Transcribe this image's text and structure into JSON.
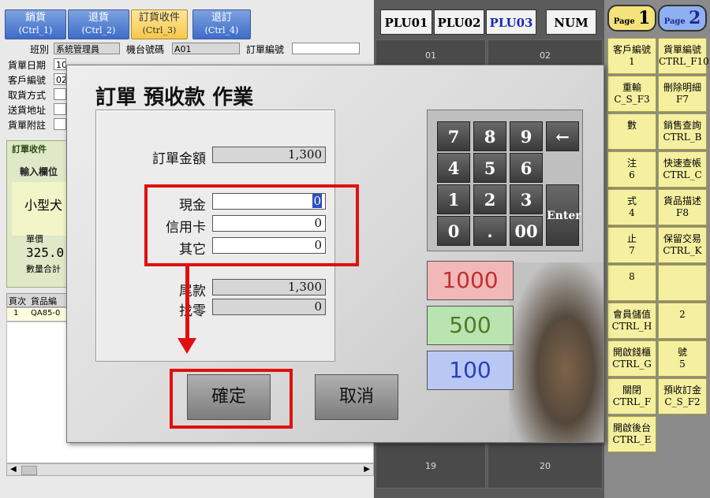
{
  "tabs": [
    {
      "label": "銷貨",
      "shortcut": "(Ctrl_1)"
    },
    {
      "label": "退貨",
      "shortcut": "(Ctrl_2)"
    },
    {
      "label": "訂貨收件",
      "shortcut": "(Ctrl_3)"
    },
    {
      "label": "退訂",
      "shortcut": "(Ctrl_4)"
    }
  ],
  "form": {
    "shift_label": "班別",
    "shift_value": "系統管理員",
    "terminal_label": "機台號碼",
    "terminal_value": "A01",
    "order_no_label": "訂單編號",
    "order_no_value": "",
    "bill_date_label": "貨單日期",
    "bill_date_value": "10",
    "customer_no_label": "客戶編號",
    "customer_no_value": "02",
    "pickup_label": "取貨方式",
    "delivery_label": "送貨地址",
    "note_label": "貨單附註",
    "receipt_fragment": "訂單收件",
    "input_fragment": "輸入欄位",
    "item_fragment": "小型犬",
    "unit_price_label": "單價",
    "unit_price_value": "325.0",
    "qty_label": "數量合計",
    "table_col1": "頁次",
    "table_col2": "貨品編",
    "row_num": "1",
    "row_code": "QA85-0"
  },
  "plu": {
    "buttons": [
      "PLU01",
      "PLU02",
      "PLU03",
      "NUM"
    ],
    "cells_top": [
      "01",
      "02"
    ],
    "cells_bottom": [
      "19",
      "20"
    ]
  },
  "pages": {
    "page1_word": "Page",
    "page1_num": "1",
    "page2_word": "Page",
    "page2_num": "2"
  },
  "right_buttons": [
    {
      "line1": "客戶編號",
      "line2": "1"
    },
    {
      "line1": "貨單編號",
      "line2": "CTRL_F10"
    },
    {
      "line1": "重輸",
      "line2": "C_S_F3"
    },
    {
      "line1": "刪除明細",
      "line2": "F7"
    },
    {
      "line1": "數",
      "line2": ""
    },
    {
      "line1": "銷售查詢",
      "line2": "CTRL_B"
    },
    {
      "line1": "注",
      "line2": "6"
    },
    {
      "line1": "快速查帳",
      "line2": "CTRL_C"
    },
    {
      "line1": "式",
      "line2": "4"
    },
    {
      "line1": "貨品描述",
      "line2": "F8"
    },
    {
      "line1": "止",
      "line2": "7"
    },
    {
      "line1": "保留交易",
      "line2": "CTRL_K"
    },
    {
      "line1": "8",
      "line2": ""
    },
    {
      "line1": "",
      "line2": ""
    },
    {
      "line1": "會員儲值",
      "line2": "CTRL_H"
    },
    {
      "line1": "2",
      "line2": ""
    },
    {
      "line1": "開啟錢櫃",
      "line2": "CTRL_G"
    },
    {
      "line1": "號",
      "line2": "5"
    },
    {
      "line1": "關閉",
      "line2": "CTRL_F"
    },
    {
      "line1": "預收訂金",
      "line2": "C_S_F2"
    },
    {
      "line1": "開啟後台",
      "line2": "CTRL_E"
    }
  ],
  "dialog": {
    "title": "訂單 預收款 作業",
    "order_amount_label": "訂單金額",
    "order_amount_value": "1,300",
    "cash_label": "現金",
    "cash_value": "0",
    "credit_label": "信用卡",
    "credit_value": "0",
    "other_label": "其它",
    "other_value": "0",
    "balance_label": "尾款",
    "balance_value": "1,300",
    "change_label": "找零",
    "change_value": "0",
    "confirm_label": "確定",
    "cancel_label": "取消"
  },
  "keypad": {
    "keys": [
      "7",
      "8",
      "9",
      "←",
      "4",
      "5",
      "6",
      "1",
      "2",
      "3",
      "0",
      ".",
      "00"
    ],
    "enter_label": "Enter"
  },
  "amount_buttons": [
    {
      "label": "1000",
      "bg": "#f2b8b8",
      "fg": "#c03030"
    },
    {
      "label": "500",
      "bg": "#b9e3b0",
      "fg": "#4f7a20"
    },
    {
      "label": "100",
      "bg": "#b8c8f2",
      "fg": "#2a3fc0"
    }
  ]
}
